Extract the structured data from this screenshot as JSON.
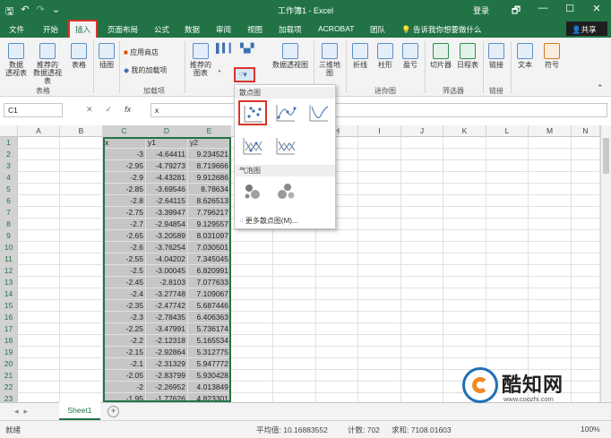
{
  "window": {
    "title": "工作簿1 - Excel",
    "login": "登录",
    "controls": [
      "🗗",
      "—",
      "☐",
      "✕"
    ]
  },
  "tabs": [
    "文件",
    "开始",
    "插入",
    "页面布局",
    "公式",
    "数据",
    "审阅",
    "视图",
    "加载项",
    "ACROBAT",
    "团队"
  ],
  "active_tab": "插入",
  "tellme": "告诉我你想要做什么",
  "share": "共享",
  "ribbon": {
    "buttons": {
      "pivot": "数据\n透视表",
      "rec_pivot": "推荐的\n数据透视表",
      "table": "表格",
      "illus": "插图",
      "store": "应用商店",
      "myaddins": "我的加载项",
      "rec_charts": "推荐的\n图表",
      "pivot_chart": "数据透视图",
      "map3d": "三维地\n图",
      "line": "折线",
      "column": "柱形",
      "winloss": "盈亏",
      "slicer": "切片器",
      "timeline": "日程表",
      "link": "链接",
      "text": "文本",
      "symbol": "符号"
    },
    "groups": {
      "tables": "表格",
      "addins": "加载项",
      "sparklines": "迷你图",
      "filters": "筛选器",
      "links": "链接"
    }
  },
  "formula": {
    "namebox": "C1",
    "fx": "fx",
    "value": "x"
  },
  "columns": [
    "A",
    "B",
    "C",
    "D",
    "E",
    "F",
    "G",
    "H",
    "I",
    "J",
    "K",
    "L",
    "M",
    "N"
  ],
  "rows": [
    [
      "1",
      "x",
      "y1",
      "y2"
    ],
    [
      "2",
      "-3",
      "-4.64411",
      "9.234521"
    ],
    [
      "3",
      "-2.95",
      "-4.79273",
      "8.719666"
    ],
    [
      "4",
      "-2.9",
      "-4.43281",
      "9.912686"
    ],
    [
      "5",
      "-2.85",
      "-3.69546",
      "8.78634"
    ],
    [
      "6",
      "-2.8",
      "-2.64115",
      "8.626513"
    ],
    [
      "7",
      "-2.75",
      "-3.39947",
      "7.796217"
    ],
    [
      "8",
      "-2.7",
      "-2.94854",
      "9.129557"
    ],
    [
      "9",
      "-2.65",
      "-3.20589",
      "8.031097"
    ],
    [
      "10",
      "-2.6",
      "-3.76254",
      "7.030501"
    ],
    [
      "11",
      "-2.55",
      "-4.04202",
      "7.345045"
    ],
    [
      "12",
      "-2.5",
      "-3.00045",
      "6.820991"
    ],
    [
      "13",
      "-2.45",
      "-2.8103",
      "7.077633"
    ],
    [
      "14",
      "-2.4",
      "-3.27748",
      "7.109067"
    ],
    [
      "15",
      "-2.35",
      "-2.47742",
      "5.687446"
    ],
    [
      "16",
      "-2.3",
      "-2.78435",
      "6.406363"
    ],
    [
      "17",
      "-2.25",
      "-3.47991",
      "5.736174"
    ],
    [
      "18",
      "-2.2",
      "-2.12318",
      "5.165534"
    ],
    [
      "19",
      "-2.15",
      "-2.92864",
      "5.312775"
    ],
    [
      "20",
      "-2.1",
      "-2.31329",
      "5.947772"
    ],
    [
      "21",
      "-2.05",
      "-2.83799",
      "5.930428"
    ],
    [
      "22",
      "-2",
      "-2.26952",
      "4.013849"
    ],
    [
      "23",
      "-1.95",
      "-1.77626",
      "4.823301"
    ],
    [
      "24",
      "-1.9",
      "-2.58862",
      "5.070537"
    ]
  ],
  "dropdown": {
    "scatter_section": "散点图",
    "bubble_section": "气泡图",
    "more": "更多散点图(M)..."
  },
  "sheet_tab": "Sheet1",
  "status": {
    "ready": "就绪",
    "average": "平均值: 10.16883552",
    "count": "计数: 702",
    "sum": "求和: 7108.01603",
    "zoom": "100%"
  },
  "watermark": {
    "name": "酷知网",
    "url": "www.coozhi.com"
  }
}
